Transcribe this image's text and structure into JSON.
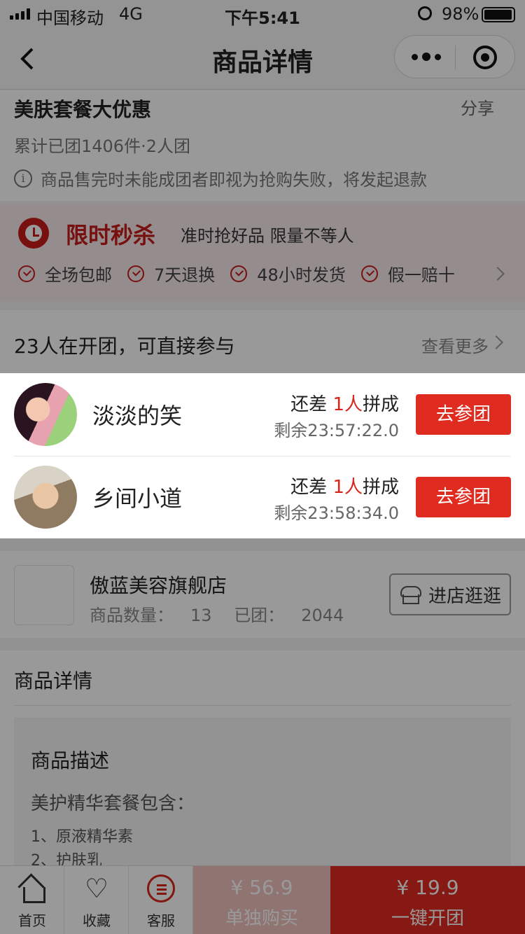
{
  "status_bar": {
    "carrier": "中国移动",
    "network": "4G",
    "time": "下午5:41",
    "battery": "98%",
    "battery_level": 0.98
  },
  "nav": {
    "title": "商品详情"
  },
  "product": {
    "name": "美肤套餐大优惠",
    "share": "分享",
    "sold": "累计已团1406件·2人团",
    "notice_icon": "i",
    "notice": "商品售完时未能成团者即视为抢购失败，将发起退款"
  },
  "flash_sale": {
    "title": "限时秒杀",
    "subtitle": "准时抢好品 限量不等人",
    "features": [
      "全场包邮",
      "7天退换",
      "48小时发货",
      "假一赔十"
    ]
  },
  "groups": {
    "title": "23人在开团，可直接参与",
    "more": "查看更多",
    "items": [
      {
        "name": "淡淡的笑",
        "need_prefix": "还差 ",
        "need_count": "1人",
        "need_suffix": "拼成",
        "remain": "剩余23:57:22.0",
        "button": "去参团"
      },
      {
        "name": "乡间小道",
        "need_prefix": "还差 ",
        "need_count": "1人",
        "need_suffix": "拼成",
        "remain": "剩余23:58:34.0",
        "button": "去参团"
      }
    ]
  },
  "shop": {
    "name": "傲蓝美容旗舰店",
    "goods_label": "商品数量：",
    "goods_count": "13",
    "sold_label": "已团：",
    "sold_count": "2044",
    "visit": "进店逛逛"
  },
  "detail": {
    "title": "商品详情",
    "desc_title": "商品描述",
    "desc_intro": "美护精华套餐包含：",
    "items": [
      "1、原液精华素",
      "2、护肤乳"
    ]
  },
  "bottom_bar": {
    "home": "首页",
    "favorite": "收藏",
    "service": "客服",
    "single_price": "¥ 56.9",
    "single_label": "单独购买",
    "group_price": "¥ 19.9",
    "group_label": "一键开团"
  },
  "colors": {
    "accent": "#e02b20",
    "flash_red": "#c81c1c"
  }
}
